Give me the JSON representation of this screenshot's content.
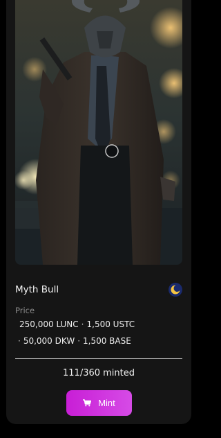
{
  "nft": {
    "name": "Myth Bull",
    "chain_icon": "terra-luna-icon",
    "artwork": "bull-headed-man-in-trench-coat-holding-gun-on-rainy-night-street"
  },
  "price": {
    "label": "Price",
    "items": [
      "250,000 LUNC",
      "1,500 USTC",
      "50,000 DKW",
      "1,500 BASE"
    ],
    "separator": "·"
  },
  "mint": {
    "minted_text": "111/360 minted",
    "button_label": "Mint",
    "button_icon": "cart-icon"
  },
  "colors": {
    "card_bg": "#151515",
    "accent": "#c81ed6",
    "accent_light": "#d64be6",
    "chain_icon_blue": "#1a2a6c",
    "chain_icon_gold": "#f5c542"
  }
}
